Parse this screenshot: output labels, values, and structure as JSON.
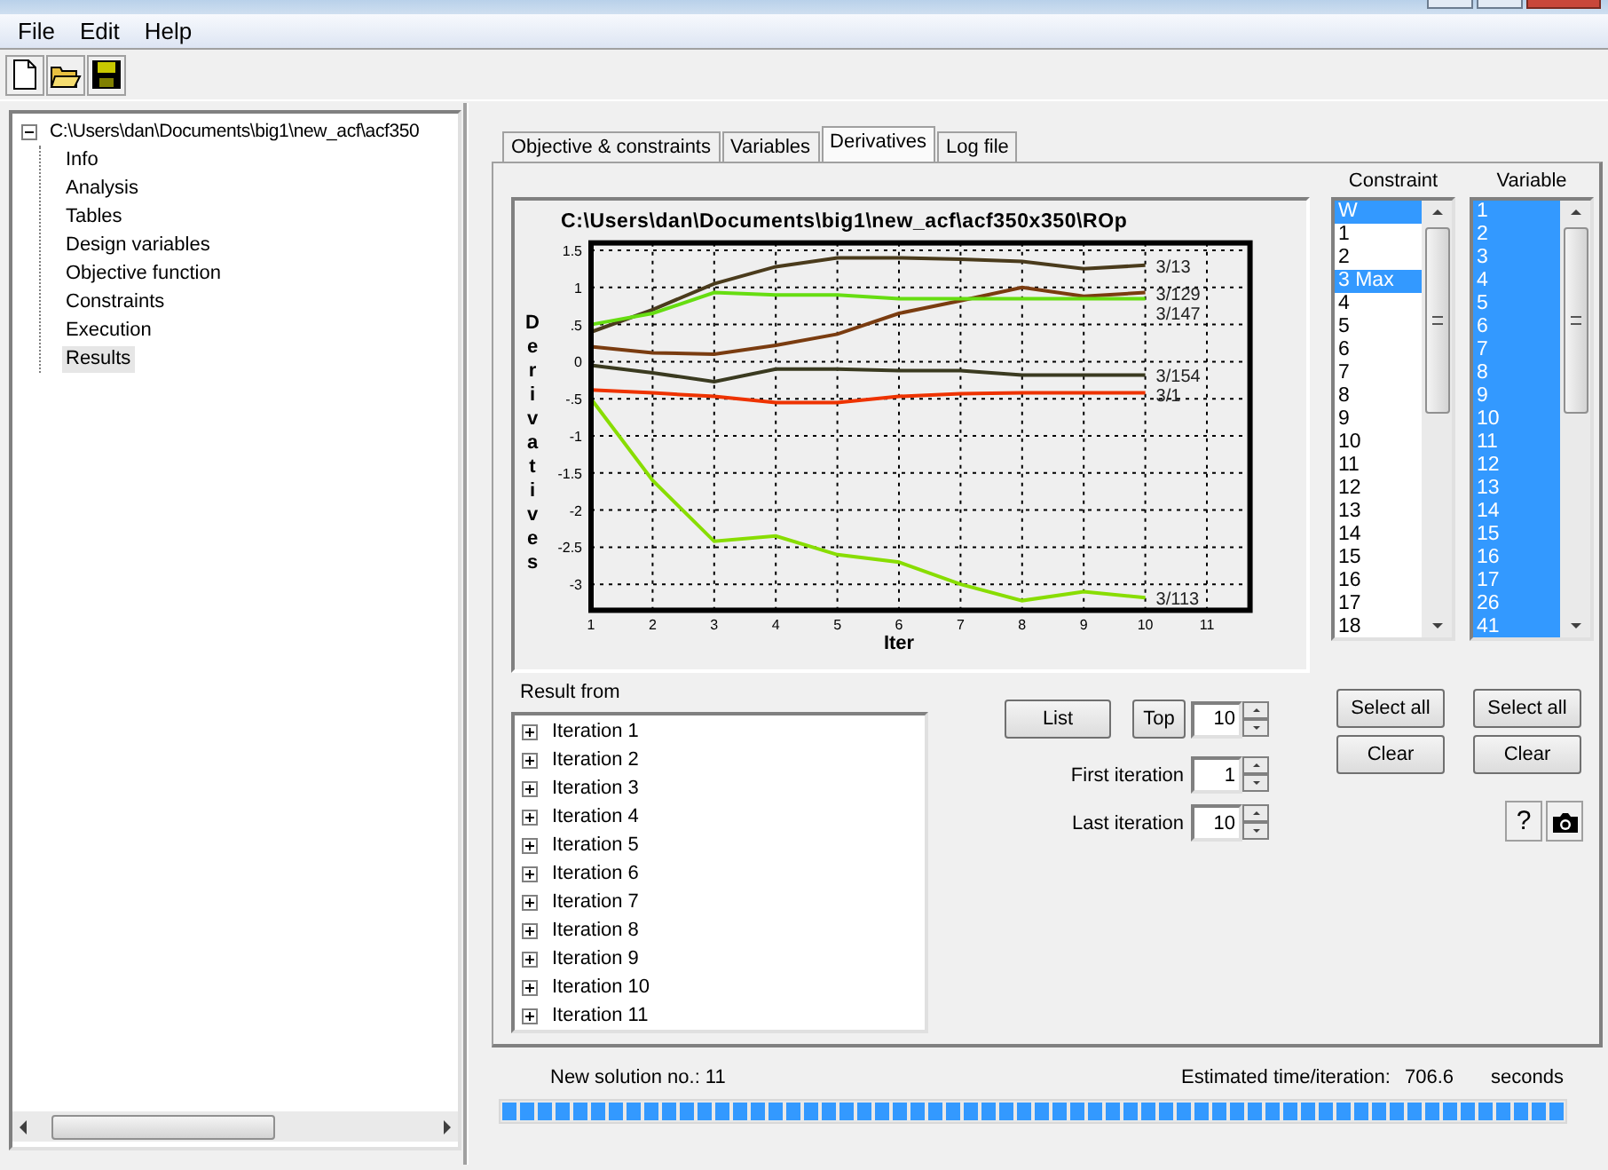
{
  "menu": [
    "File",
    "Edit",
    "Help"
  ],
  "toolbar": [
    {
      "kind": "new"
    },
    {
      "kind": "open"
    },
    {
      "kind": "save"
    }
  ],
  "project_tree": {
    "root": "C:\\Users\\dan\\Documents\\big1\\new_acf\\acf350",
    "expanded": true,
    "children": [
      {
        "label": "Info",
        "selected": false
      },
      {
        "label": "Analysis",
        "selected": false
      },
      {
        "label": "Tables",
        "selected": false
      },
      {
        "label": "Design variables",
        "selected": false
      },
      {
        "label": "Objective function",
        "selected": false
      },
      {
        "label": "Constraints",
        "selected": false
      },
      {
        "label": "Execution",
        "selected": false
      },
      {
        "label": "Results",
        "selected": true
      }
    ]
  },
  "tabs": [
    {
      "label": "Objective & constraints",
      "selected": false
    },
    {
      "label": "Variables",
      "selected": false
    },
    {
      "label": "Derivatives",
      "selected": true
    },
    {
      "label": "Log file",
      "selected": false
    }
  ],
  "chart": {
    "chart_data": {
      "type": "line",
      "grid": true,
      "title": "C:\\Users\\dan\\Documents\\big1\\new_acf\\acf350x350\\ROp",
      "xlabel": "Iter",
      "ylabel": "Derivatives",
      "x": [
        1,
        2,
        3,
        4,
        5,
        6,
        7,
        8,
        9,
        10
      ],
      "xlim": [
        1,
        11.7
      ],
      "ylim": [
        -3.35,
        1.6
      ],
      "xticks": [
        1,
        2,
        3,
        4,
        5,
        6,
        7,
        8,
        9,
        10,
        11
      ],
      "yticks": [
        1.5,
        1,
        {
          "value": 0.5,
          "label": ".5"
        },
        0,
        {
          "value": -0.5,
          "label": "-.5"
        },
        -1,
        -1.5,
        -2,
        -2.5,
        -3
      ],
      "series": [
        {
          "name": "3/13",
          "color": "#4a3b1c",
          "values": [
            0.4,
            0.7,
            1.05,
            1.28,
            1.4,
            1.4,
            1.38,
            1.35,
            1.25,
            1.3
          ]
        },
        {
          "name": "3/129",
          "color": "#7a3c10",
          "values": [
            0.2,
            0.12,
            0.1,
            0.22,
            0.37,
            0.65,
            0.82,
            1.0,
            0.88,
            0.93
          ]
        },
        {
          "name": "3/147",
          "color": "#66dd11",
          "values": [
            0.5,
            0.65,
            0.93,
            0.9,
            0.9,
            0.85,
            0.85,
            0.85,
            0.85,
            0.85
          ]
        },
        {
          "name": "3/154",
          "color": "#3a3a20",
          "values": [
            -0.05,
            -0.15,
            -0.27,
            -0.1,
            -0.1,
            -0.12,
            -0.12,
            -0.18,
            -0.18,
            -0.18
          ]
        },
        {
          "name": "3/1",
          "color": "#ee3300",
          "values": [
            -0.38,
            -0.42,
            -0.47,
            -0.55,
            -0.55,
            -0.47,
            -0.43,
            -0.42,
            -0.42,
            -0.42
          ]
        },
        {
          "name": "3/113",
          "color": "#88dd00",
          "values": [
            -0.5,
            -1.6,
            -2.42,
            -2.35,
            -2.6,
            -2.7,
            -3.0,
            -3.22,
            -3.1,
            -3.18
          ]
        }
      ]
    }
  },
  "constraint_list": {
    "heading": "Constraint",
    "items": [
      {
        "label": "W",
        "selected": true
      },
      {
        "label": "1",
        "selected": false
      },
      {
        "label": "2",
        "selected": false
      },
      {
        "label": "3 Max",
        "selected": true
      },
      {
        "label": "4",
        "selected": false
      },
      {
        "label": "5",
        "selected": false
      },
      {
        "label": "6",
        "selected": false
      },
      {
        "label": "7",
        "selected": false
      },
      {
        "label": "8",
        "selected": false
      },
      {
        "label": "9",
        "selected": false
      },
      {
        "label": "10",
        "selected": false
      },
      {
        "label": "11",
        "selected": false
      },
      {
        "label": "12",
        "selected": false
      },
      {
        "label": "13",
        "selected": false
      },
      {
        "label": "14",
        "selected": false
      },
      {
        "label": "15",
        "selected": false
      },
      {
        "label": "16",
        "selected": false
      },
      {
        "label": "17",
        "selected": false
      },
      {
        "label": "18",
        "selected": false
      }
    ],
    "buttons": [
      "Select all",
      "Clear"
    ]
  },
  "variable_list": {
    "heading": "Variable",
    "items": [
      {
        "label": "1",
        "selected": true
      },
      {
        "label": "2",
        "selected": true
      },
      {
        "label": "3",
        "selected": true
      },
      {
        "label": "4",
        "selected": true
      },
      {
        "label": "5",
        "selected": true
      },
      {
        "label": "6",
        "selected": true
      },
      {
        "label": "7",
        "selected": true
      },
      {
        "label": "8",
        "selected": true
      },
      {
        "label": "9",
        "selected": true
      },
      {
        "label": "10",
        "selected": true
      },
      {
        "label": "11",
        "selected": true
      },
      {
        "label": "12",
        "selected": true
      },
      {
        "label": "13",
        "selected": true
      },
      {
        "label": "14",
        "selected": true
      },
      {
        "label": "15",
        "selected": true
      },
      {
        "label": "16",
        "selected": true
      },
      {
        "label": "17",
        "selected": true
      },
      {
        "label": "26",
        "selected": true
      },
      {
        "label": "41",
        "selected": true
      }
    ],
    "buttons": [
      "Select all",
      "Clear"
    ]
  },
  "result_from": {
    "heading": "Result from",
    "items": [
      {
        "label": "Iteration 1",
        "expanded": false
      },
      {
        "label": "Iteration 2",
        "expanded": false
      },
      {
        "label": "Iteration 3",
        "expanded": false
      },
      {
        "label": "Iteration 4",
        "expanded": false
      },
      {
        "label": "Iteration 5",
        "expanded": false
      },
      {
        "label": "Iteration 6",
        "expanded": false
      },
      {
        "label": "Iteration 7",
        "expanded": false
      },
      {
        "label": "Iteration 8",
        "expanded": false
      },
      {
        "label": "Iteration 9",
        "expanded": false
      },
      {
        "label": "Iteration 10",
        "expanded": false
      },
      {
        "label": "Iteration 11",
        "expanded": false
      }
    ]
  },
  "controls": {
    "list_button": "List",
    "top_button": "Top",
    "top_value": "10",
    "first_label": "First iteration",
    "first_value": "1",
    "last_label": "Last iteration",
    "last_value": "10",
    "help_button": "?"
  },
  "status": {
    "solution": "New solution no.:  11",
    "time_label": "Estimated time/iteration:",
    "time_value": "706.6",
    "time_unit": "seconds",
    "progress": {
      "level": 1
    }
  }
}
